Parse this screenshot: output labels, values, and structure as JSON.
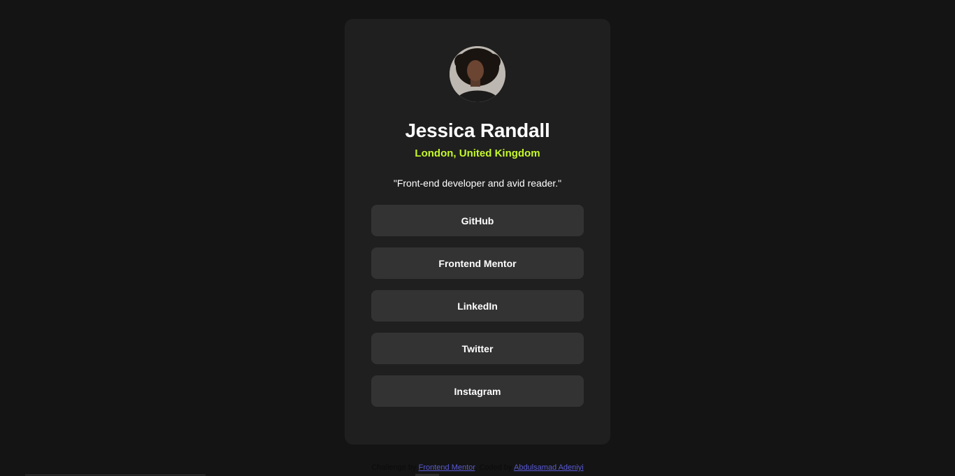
{
  "profile": {
    "name": "Jessica Randall",
    "location": "London, United Kingdom",
    "bio": "\"Front-end developer and avid reader.\""
  },
  "links": [
    "GitHub",
    "Frontend Mentor",
    "LinkedIn",
    "Twitter",
    "Instagram"
  ],
  "attribution": {
    "prefix": "Challenge by",
    "challenge_link": "Frontend Mentor",
    "middle": ". Coded by",
    "author_link": "Abdulsamad Adeniyi"
  },
  "colors": {
    "background": "#141414",
    "card": "#1f1f1f",
    "button": "#333333",
    "accent": "#c4f82a"
  }
}
